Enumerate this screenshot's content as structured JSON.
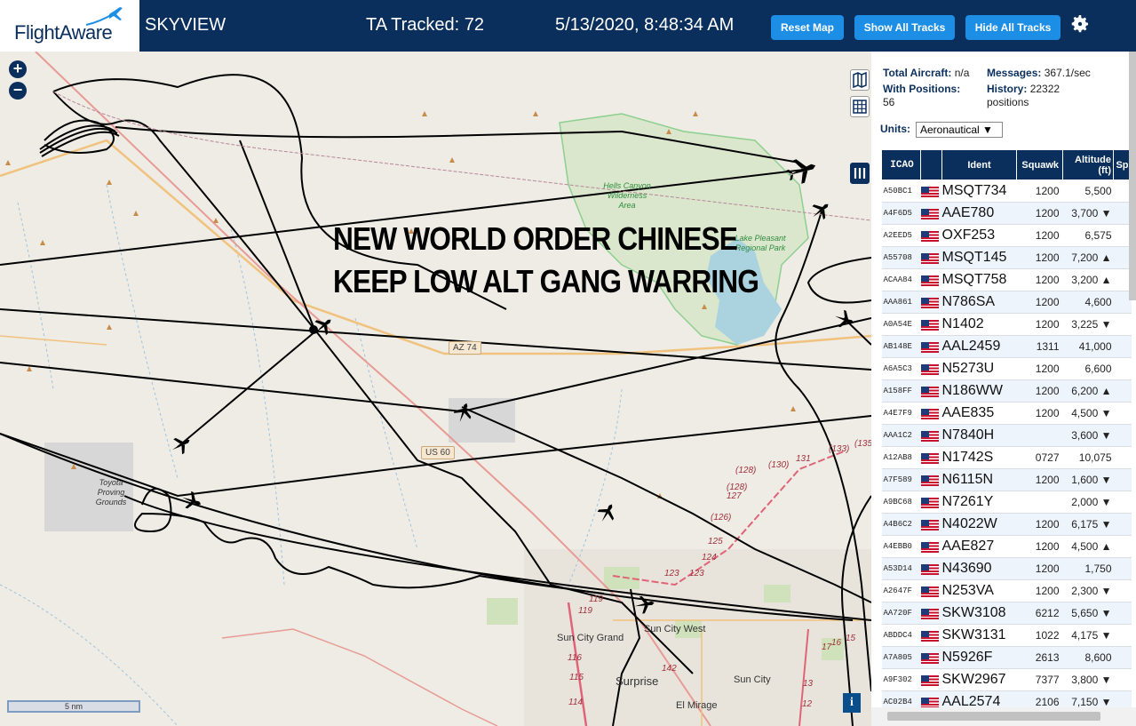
{
  "header": {
    "logo": "FlightAware",
    "app_title": "SKYVIEW",
    "tracked": "TA Tracked: 72",
    "datetime": "5/13/2020, 8:48:34 AM",
    "reset_label": "Reset Map",
    "show_label": "Show All Tracks",
    "hide_label": "Hide All Tracks",
    "accent": "#1c8ee6",
    "bar_color": "#0a2f5c"
  },
  "map": {
    "overlay_line1": "NEW WORLD ORDER CHINESE",
    "overlay_line2": "KEEP LOW ALT GANG WARRING",
    "zoom_in": "+",
    "zoom_out": "−",
    "scale_label": "5 nm",
    "info_label": "i",
    "labels": {
      "hells_canyon": "Hells Canyon Wilderness Area",
      "lake_pleasant": "Lake Pleasant Regional Park",
      "toyota": "Toyota Proving Grounds",
      "sun_city_grand": "Sun City Grand",
      "sun_city_west": "Sun City West",
      "surprise": "Surprise",
      "sun_city": "Sun City",
      "el_mirage": "El Mirage",
      "az74": "AZ 74",
      "us60": "US 60"
    }
  },
  "panel": {
    "total_aircraft_label": "Total Aircraft:",
    "total_aircraft_value": "n/a",
    "messages_label": "Messages:",
    "messages_value": "367.1/sec",
    "with_positions_label": "With Positions:",
    "with_positions_value": "56",
    "history_label": "History:",
    "history_value": "22322 positions",
    "units_label": "Units:",
    "units_value": "Aeronautical ▼",
    "columns": [
      "ICAO",
      "",
      "Ident",
      "Squawk",
      "Altitude (ft)",
      "Sp"
    ],
    "rows": [
      {
        "icao": "A50BC1",
        "ident": "MSQT734",
        "squawk": "1200",
        "alt": "5,500"
      },
      {
        "icao": "A4F6D5",
        "ident": "AAE780",
        "squawk": "1200",
        "alt": "3,700 ▼"
      },
      {
        "icao": "A2EED5",
        "ident": "OXF253",
        "squawk": "1200",
        "alt": "6,575"
      },
      {
        "icao": "A55708",
        "ident": "MSQT145",
        "squawk": "1200",
        "alt": "7,200 ▲"
      },
      {
        "icao": "ACAA84",
        "ident": "MSQT758",
        "squawk": "1200",
        "alt": "3,200 ▲"
      },
      {
        "icao": "AAA861",
        "ident": "N786SA",
        "squawk": "1200",
        "alt": "4,600"
      },
      {
        "icao": "A0A54E",
        "ident": "N1402",
        "squawk": "1200",
        "alt": "3,225 ▼"
      },
      {
        "icao": "AB148E",
        "ident": "AAL2459",
        "squawk": "1311",
        "alt": "41,000"
      },
      {
        "icao": "A6A5C3",
        "ident": "N5273U",
        "squawk": "1200",
        "alt": "6,600"
      },
      {
        "icao": "A158FF",
        "ident": "N186WW",
        "squawk": "1200",
        "alt": "6,200 ▲"
      },
      {
        "icao": "A4E7F9",
        "ident": "AAE835",
        "squawk": "1200",
        "alt": "4,500 ▼"
      },
      {
        "icao": "AAA1C2",
        "ident": "N7840H",
        "squawk": "",
        "alt": "3,600 ▼"
      },
      {
        "icao": "A12AB8",
        "ident": "N1742S",
        "squawk": "0727",
        "alt": "10,075"
      },
      {
        "icao": "A7F589",
        "ident": "N6115N",
        "squawk": "1200",
        "alt": "1,600 ▼"
      },
      {
        "icao": "A9BC68",
        "ident": "N7261Y",
        "squawk": "",
        "alt": "2,000 ▼"
      },
      {
        "icao": "A4B6C2",
        "ident": "N4022W",
        "squawk": "1200",
        "alt": "6,175 ▼"
      },
      {
        "icao": "A4EBB0",
        "ident": "AAE827",
        "squawk": "1200",
        "alt": "4,500 ▲"
      },
      {
        "icao": "A53D14",
        "ident": "N43690",
        "squawk": "1200",
        "alt": "1,750"
      },
      {
        "icao": "A2647F",
        "ident": "N253VA",
        "squawk": "1200",
        "alt": "2,300 ▼"
      },
      {
        "icao": "AA720F",
        "ident": "SKW3108",
        "squawk": "6212",
        "alt": "5,650 ▼"
      },
      {
        "icao": "ABDDC4",
        "ident": "SKW3131",
        "squawk": "1022",
        "alt": "4,175 ▼"
      },
      {
        "icao": "A7A805",
        "ident": "N5926F",
        "squawk": "2613",
        "alt": "8,600"
      },
      {
        "icao": "A9F302",
        "ident": "SKW2967",
        "squawk": "7377",
        "alt": "3,800 ▼"
      },
      {
        "icao": "AC02B4",
        "ident": "AAL2574",
        "squawk": "2106",
        "alt": "7,150 ▼"
      }
    ]
  }
}
